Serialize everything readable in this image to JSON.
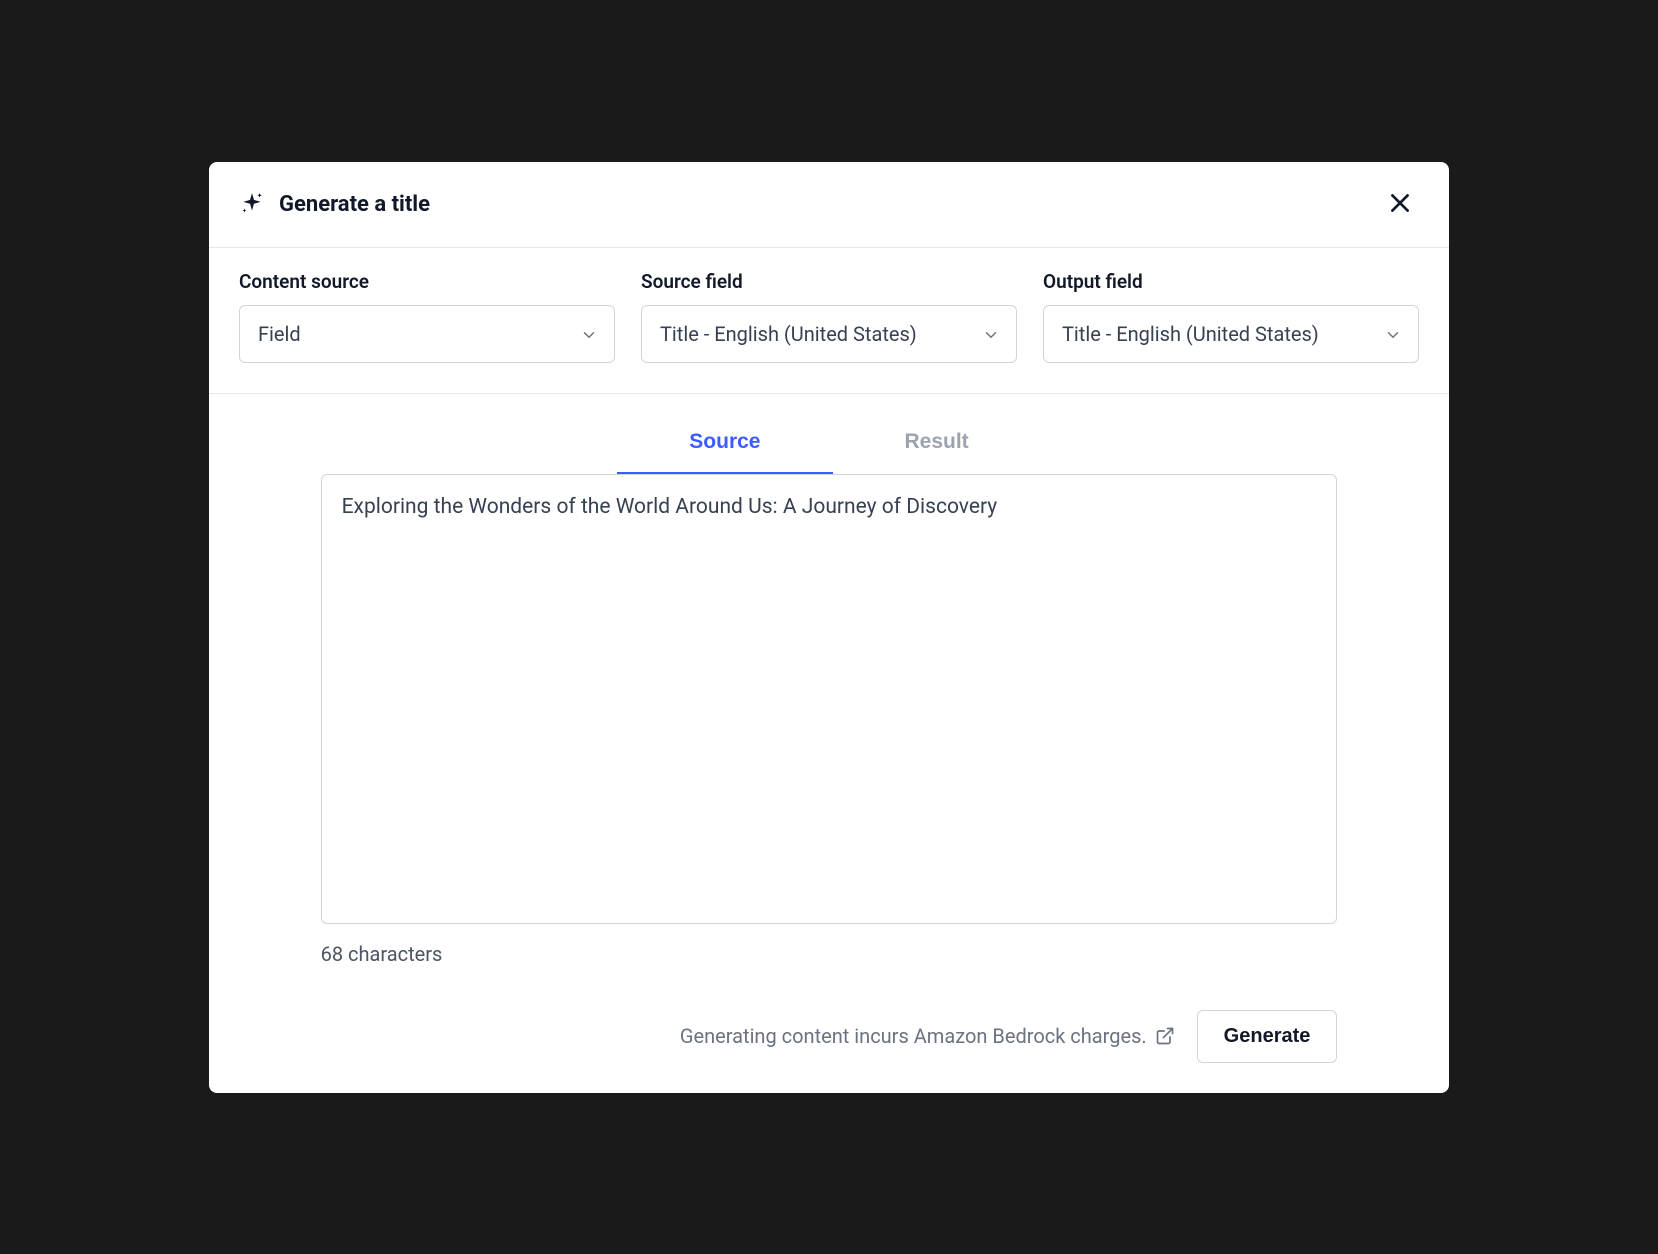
{
  "modal": {
    "title": "Generate a title"
  },
  "form": {
    "content_source": {
      "label": "Content source",
      "value": "Field"
    },
    "source_field": {
      "label": "Source field",
      "value": "Title - English (United States)"
    },
    "output_field": {
      "label": "Output field",
      "value": "Title - English (United States)"
    }
  },
  "tabs": {
    "source": "Source",
    "result": "Result"
  },
  "textarea": {
    "value": "Exploring the Wonders of the World Around Us: A Journey of Discovery",
    "char_count_text": "68 characters"
  },
  "footer": {
    "disclaimer": "Generating content incurs Amazon Bedrock charges.",
    "generate_label": "Generate"
  }
}
